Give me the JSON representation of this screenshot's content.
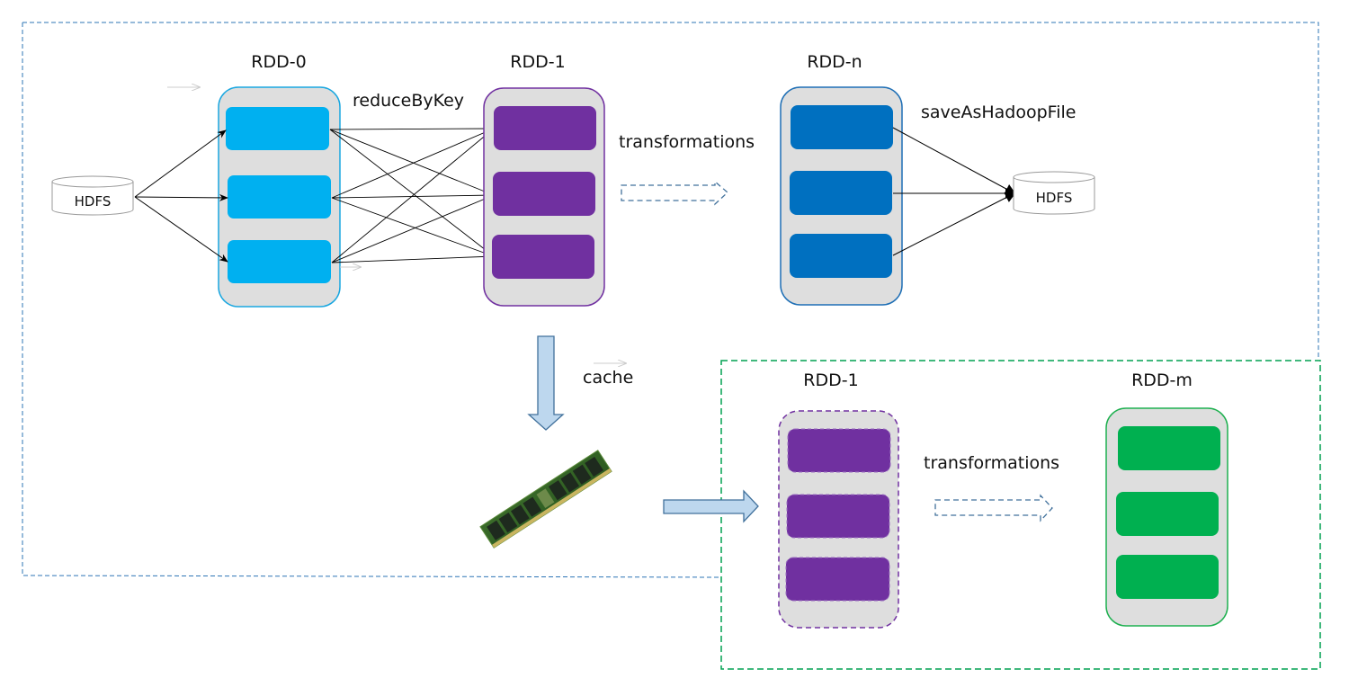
{
  "colors": {
    "rdd0_border": "#1aa7e0",
    "rdd0_partition": "#00b0f0",
    "rdd1_border": "#7030a0",
    "rdd1_partition": "#7030a0",
    "rddn_border": "#1f6fb5",
    "rddn_partition": "#0070c0",
    "rddm_border": "#1fb050",
    "rddm_partition": "#00b050",
    "container_fill": "#dedede",
    "outer_box": "#2e75b6",
    "inner_box": "#00a050",
    "block_arrow_fill": "#bdd7ee",
    "block_arrow_stroke": "#41719c",
    "dashed_arrow": "#41719c"
  },
  "sources": {
    "hdfs_in": "HDFS",
    "hdfs_out": "HDFS"
  },
  "rdds": {
    "rdd0": {
      "title": "RDD-0",
      "partitions": 3
    },
    "rdd1": {
      "title": "RDD-1",
      "partitions": 3
    },
    "rddn": {
      "title": "RDD-n",
      "partitions": 3
    },
    "rdd1_cached": {
      "title": "RDD-1",
      "partitions": 3
    },
    "rddm": {
      "title": "RDD-m",
      "partitions": 3
    }
  },
  "operations": {
    "reduce": "reduceByKey",
    "transform_top": "transformations",
    "save": "saveAsHadoopFile",
    "cache": "cache",
    "transform_bottom": "transformations"
  },
  "memory": {
    "icon": "ram-module-icon"
  }
}
